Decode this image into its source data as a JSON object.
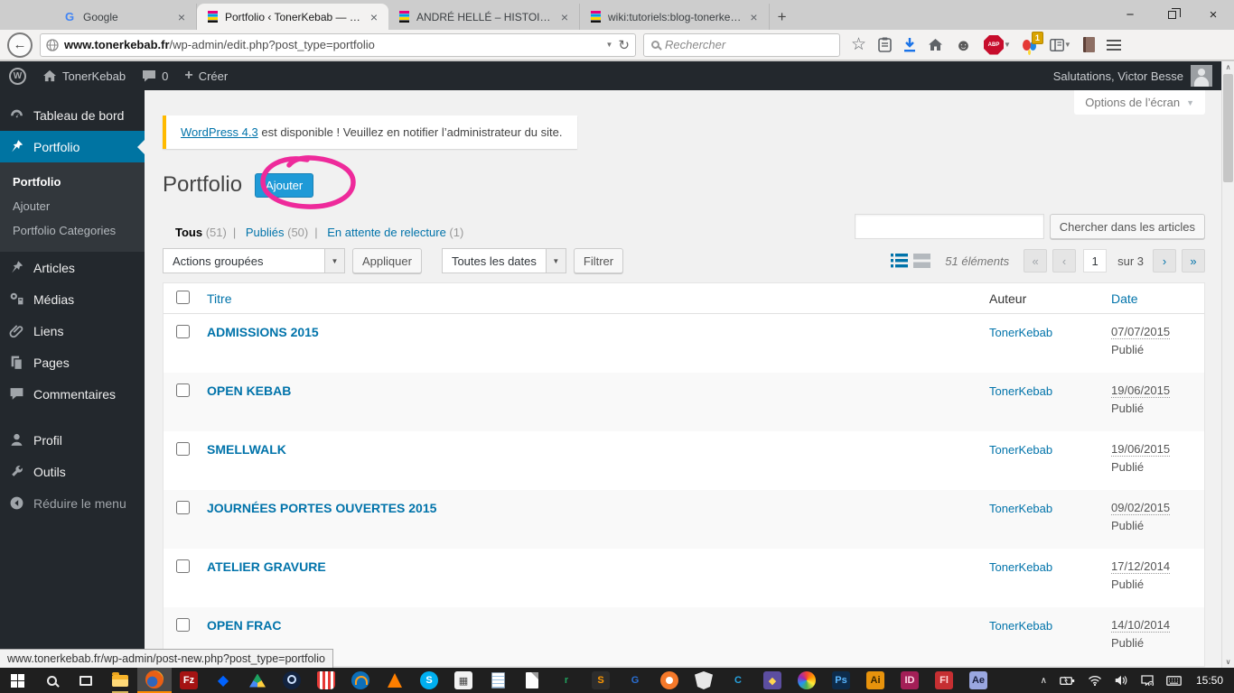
{
  "browser": {
    "tabs": [
      {
        "label": "Google",
        "cls": "fav-google",
        "favicon_glyph": "G"
      },
      {
        "label": "Portfolio ‹ TonerKebab — Wor…",
        "cls": "fav-toner",
        "active": true
      },
      {
        "label": "ANDRÉ HELLÉ – HISTOIRE …",
        "cls": "fav-toner"
      },
      {
        "label": "wiki:tutoriels:blog-tonerke…",
        "cls": "fav-toner"
      }
    ],
    "glyphs": {
      "close_tab": "×",
      "new_tab": "+",
      "back": "←",
      "caret": "▼",
      "reload": "↻",
      "star": "☆",
      "smiley": "☻",
      "minimize": "−",
      "close_win": "×",
      "scroll_up": "∧",
      "scroll_down": "∨"
    },
    "url_domain": "www.tonerkebab.fr",
    "url_path": "/wp-admin/edit.php?post_type=portfolio",
    "search_placeholder": "Rechercher",
    "abp_label": "ABP",
    "addon_badge": "1"
  },
  "admin_bar": {
    "wp_glyph": "W",
    "site_name": "TonerKebab",
    "comment_count": "0",
    "new_glyph": "+",
    "new_label": "Créer",
    "greeting": "Salutations, Victor Besse"
  },
  "screen_options_label": "Options de l’écran",
  "notice": {
    "link_text": "WordPress 4.3",
    "message": " est disponible ! Veuillez en notifier l’administrateur du site."
  },
  "page_title": "Portfolio",
  "add_new_label": "Ajouter",
  "annotation_color": "#ee2a9b",
  "sidebar": {
    "dashboard": "Tableau de bord",
    "portfolio": "Portfolio",
    "sub_portfolio": "Portfolio",
    "sub_add": "Ajouter",
    "sub_categories": "Portfolio Categories",
    "articles": "Articles",
    "medias": "Médias",
    "liens": "Liens",
    "pages": "Pages",
    "commentaires": "Commentaires",
    "profil": "Profil",
    "outils": "Outils",
    "collapse": "Réduire le menu"
  },
  "filters": [
    {
      "label": "Tous",
      "count": "(51)",
      "cls": "f-current",
      "sep": ""
    },
    {
      "label": "Publiés",
      "count": "(50)",
      "sep": "|"
    },
    {
      "label": "En attente de relecture",
      "count": "(1)",
      "sep": "|"
    }
  ],
  "list_toolbar": {
    "bulk_actions": "Actions groupées",
    "apply": "Appliquer",
    "all_dates": "Toutes les dates",
    "filter": "Filtrer",
    "search_button": "Chercher dans les articles"
  },
  "pagination": {
    "items_total": "51 éléments",
    "first": "«",
    "prev": "‹",
    "current_page": "1",
    "of_pages": "sur 3",
    "next": "›",
    "last": "»"
  },
  "table": {
    "headers": {
      "title": "Titre",
      "author": "Auteur",
      "date": "Date"
    },
    "rows": [
      {
        "title": "ADMISSIONS 2015",
        "author": "TonerKebab",
        "date": "07/07/2015",
        "status": "Publié"
      },
      {
        "title": "OPEN KEBAB",
        "author": "TonerKebab",
        "date": "19/06/2015",
        "status": "Publié"
      },
      {
        "title": "SMELLWALK",
        "author": "TonerKebab",
        "date": "19/06/2015",
        "status": "Publié"
      },
      {
        "title": "JOURNÉES PORTES OUVERTES 2015",
        "author": "TonerKebab",
        "date": "09/02/2015",
        "status": "Publié"
      },
      {
        "title": "ATELIER GRAVURE",
        "author": "TonerKebab",
        "date": "17/12/2014",
        "status": "Publié"
      },
      {
        "title": "OPEN FRAC",
        "author": "TonerKebab",
        "date": "14/10/2014",
        "status": "Publié"
      }
    ]
  },
  "status_bar_url": "www.tonerkebab.fr/wp-admin/post-new.php?post_type=portfolio",
  "taskbar": {
    "time": "15:50",
    "apps": [
      {
        "name": "start",
        "cls": "ic-start",
        "glyph": ""
      },
      {
        "name": "search",
        "cls": "ic-search",
        "glyph": ""
      },
      {
        "name": "task-view",
        "cls": "ic-taskview",
        "glyph": ""
      },
      {
        "name": "file-explorer",
        "cls": "ic-explorer open",
        "glyph": ""
      },
      {
        "name": "firefox",
        "cls": "ic-firefox circle",
        "glyph": "",
        "active": true
      },
      {
        "name": "filezilla",
        "glyph": "Fz",
        "bg": "#a51313",
        "fg": "#ffffff"
      },
      {
        "name": "dropbox",
        "cls": "ic-dropbox",
        "glyph": "◆"
      },
      {
        "name": "google-drive",
        "cls": "ic-drive",
        "glyph": ""
      },
      {
        "name": "steam",
        "cls": "ic-steam circle",
        "glyph": ""
      },
      {
        "name": "popcorn-time",
        "cls": "ic-popcorn",
        "glyph": ""
      },
      {
        "name": "audio-app",
        "cls": "ic-headphones circle",
        "glyph": ""
      },
      {
        "name": "vlc",
        "cls": "ic-vlc",
        "glyph": ""
      },
      {
        "name": "skype",
        "cls": "circle",
        "glyph": "S",
        "bg": "#00aff0",
        "fg": "#ffffff"
      },
      {
        "name": "calculator",
        "glyph": "▦",
        "bg": "#f2f2f2",
        "fg": "#444444"
      },
      {
        "name": "notepad",
        "cls": "ic-notepad",
        "glyph": ""
      },
      {
        "name": "document-app",
        "cls": "ic-page",
        "glyph": ""
      },
      {
        "name": "r-app",
        "glyph": "r",
        "bg": "transparent",
        "fg": "#21a35f"
      },
      {
        "name": "sublime-text",
        "glyph": "S",
        "bg": "#2d2d2d",
        "fg": "#ff9800"
      },
      {
        "name": "gimp",
        "glyph": "G",
        "bg": "transparent",
        "fg": "#2a6fd3"
      },
      {
        "name": "blender",
        "cls": "ic-blender circle",
        "glyph": ""
      },
      {
        "name": "shield-app",
        "cls": "ic-shield",
        "glyph": ""
      },
      {
        "name": "c-app",
        "glyph": "C",
        "bg": "transparent",
        "fg": "#27a3e0"
      },
      {
        "name": "purple-app",
        "glyph": "◆",
        "bg": "#5c4ea0",
        "fg": "#ffd54f"
      },
      {
        "name": "color-wheel-app",
        "cls": "ic-colorwheel circle",
        "glyph": ""
      },
      {
        "name": "photoshop",
        "glyph": "Ps",
        "bg": "#0d2b4a",
        "fg": "#5ab6ff"
      },
      {
        "name": "illustrator",
        "glyph": "Ai",
        "bg": "#e8930c",
        "fg": "#3a2600"
      },
      {
        "name": "indesign",
        "glyph": "ID",
        "bg": "#a31f57",
        "fg": "#ffd9e8"
      },
      {
        "name": "flash",
        "glyph": "Fl",
        "bg": "#c62f32",
        "fg": "#ffd9d9"
      },
      {
        "name": "after-effects",
        "glyph": "Ae",
        "bg": "#9aa7e0",
        "fg": "#1a2040"
      }
    ]
  }
}
